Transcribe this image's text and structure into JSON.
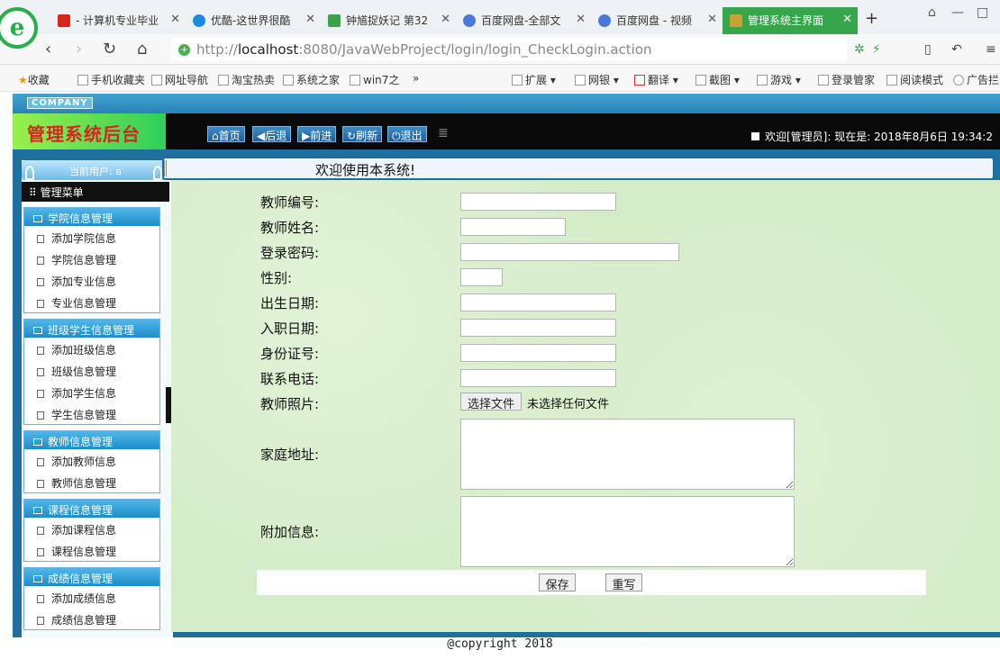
{
  "browser": {
    "tabs": [
      {
        "label": "- 计算机专业毕业",
        "favicon_color": "#d9261c"
      },
      {
        "label": "优酷-这世界很酷",
        "favicon_color": "#1e88e5"
      },
      {
        "label": "钟馗捉妖记 第32",
        "favicon_color": "#3aa34a"
      },
      {
        "label": "百度网盘-全部文",
        "favicon_color": "#4a78d8"
      },
      {
        "label": "百度网盘 - 视频",
        "favicon_color": "#4a78d8"
      },
      {
        "label": "管理系统主界面",
        "favicon_color": "#c8a233"
      }
    ],
    "active_tab": 5,
    "new_tab": "+",
    "url_scheme": "http://",
    "url_host": "localhost",
    "url_rest": ":8080/JavaWebProject/login/login_CheckLogin.action",
    "bookmarks": [
      "收藏",
      "手机收藏夹",
      "网址导航",
      "淘宝热卖",
      "系统之家",
      "win7之",
      "»",
      "扩展",
      "网银",
      "翻译",
      "截图",
      "游戏",
      "登录管家",
      "阅读模式",
      "广告拦"
    ]
  },
  "app": {
    "company": "COMPANY",
    "title": "管理系统后台",
    "nav_buttons": [
      "首页",
      "后退",
      "前进",
      "刷新",
      "退出"
    ],
    "welcome": "欢迎[管理员]: 现在是: 2018年8月6日 19:34:2",
    "current_user": "当前用户: a",
    "menu_title": "管理菜单",
    "groups": [
      {
        "title": "学院信息管理",
        "items": [
          "添加学院信息",
          "学院信息管理",
          "添加专业信息",
          "专业信息管理"
        ]
      },
      {
        "title": "班级学生信息管理",
        "items": [
          "添加班级信息",
          "班级信息管理",
          "添加学生信息",
          "学生信息管理"
        ]
      },
      {
        "title": "教师信息管理",
        "items": [
          "添加教师信息",
          "教师信息管理"
        ]
      },
      {
        "title": "课程信息管理",
        "items": [
          "添加课程信息",
          "课程信息管理"
        ]
      },
      {
        "title": "成绩信息管理",
        "items": [
          "添加成绩信息",
          "成绩信息管理"
        ]
      }
    ],
    "banner": "欢迎使用本系统!"
  },
  "form": {
    "teacher_no": {
      "label": "教师编号:",
      "value": ""
    },
    "teacher_name": {
      "label": "教师姓名:",
      "value": ""
    },
    "password": {
      "label": "登录密码:",
      "value": ""
    },
    "gender": {
      "label": "性别:",
      "value": ""
    },
    "birth_date": {
      "label": "出生日期:",
      "value": ""
    },
    "hire_date": {
      "label": "入职日期:",
      "value": ""
    },
    "id_card": {
      "label": "身份证号:",
      "value": ""
    },
    "phone": {
      "label": "联系电话:",
      "value": ""
    },
    "photo": {
      "label": "教师照片:",
      "button": "选择文件",
      "status": "未选择任何文件"
    },
    "address": {
      "label": "家庭地址:",
      "value": ""
    },
    "extra": {
      "label": "附加信息:",
      "value": ""
    },
    "save": "保存",
    "reset": "重写"
  },
  "footer": {
    "copyright": "@copyright 2018"
  }
}
